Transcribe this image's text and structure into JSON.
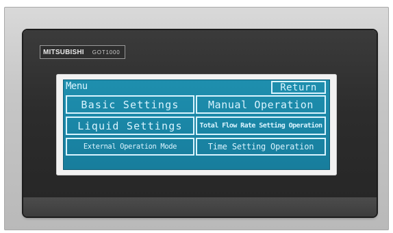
{
  "device": {
    "brand": "MITSUBISHI",
    "model": "GOT1000"
  },
  "screen": {
    "title": "Menu",
    "return_label": "Return",
    "buttons": [
      {
        "label": "Basic Settings"
      },
      {
        "label": "Manual Operation"
      },
      {
        "label": "Liquid Settings"
      },
      {
        "label": "Total Flow Rate Setting Operation"
      },
      {
        "label": "External Operation Mode"
      },
      {
        "label": "Time Setting Operation"
      }
    ]
  },
  "colors": {
    "lcd_background": "#1a86a6",
    "lcd_text": "#d9f4ff",
    "panel": "#2c2c2c",
    "bezel": "#c6c6c6"
  }
}
